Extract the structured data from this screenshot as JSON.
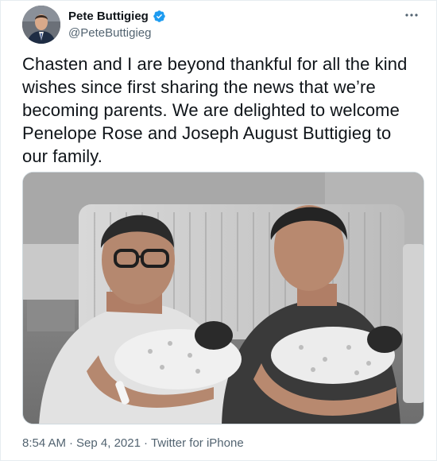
{
  "author": {
    "display_name": "Pete Buttigieg",
    "handle": "@PeteButtigieg",
    "verified": true
  },
  "tweet": {
    "text": "Chasten and I are beyond thankful for all the kind wishes since first sharing the news that we’re becoming parents. We are delighted to welcome Penelope Rose and Joseph August Buttigieg to our family.",
    "time": "8:54 AM",
    "separator": "·",
    "date": "Sep 4, 2021",
    "source": "Twitter for iPhone"
  },
  "colors": {
    "verified_blue": "#1d9bf0",
    "text_primary": "#0f1419",
    "text_secondary": "#536471"
  },
  "icons": {
    "more": "more-horizontal-icon",
    "verified": "verified-badge-icon"
  }
}
